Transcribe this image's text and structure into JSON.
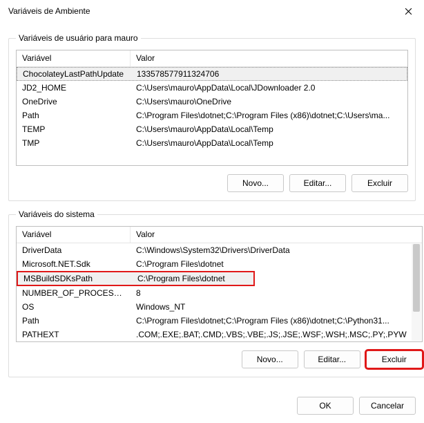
{
  "titlebar": {
    "title": "Variáveis de Ambiente"
  },
  "user_group": {
    "legend": "Variáveis de usuário para mauro",
    "header_var": "Variável",
    "header_val": "Valor",
    "rows": [
      {
        "var": "ChocolateyLastPathUpdate",
        "val": "133578577911324706"
      },
      {
        "var": "JD2_HOME",
        "val": "C:\\Users\\mauro\\AppData\\Local\\JDownloader 2.0"
      },
      {
        "var": "OneDrive",
        "val": "C:\\Users\\mauro\\OneDrive"
      },
      {
        "var": "Path",
        "val": "C:\\Program Files\\dotnet;C:\\Program Files (x86)\\dotnet;C:\\Users\\ma..."
      },
      {
        "var": "TEMP",
        "val": "C:\\Users\\mauro\\AppData\\Local\\Temp"
      },
      {
        "var": "TMP",
        "val": "C:\\Users\\mauro\\AppData\\Local\\Temp"
      }
    ],
    "selected_index": 0,
    "buttons": {
      "novo": "Novo...",
      "editar": "Editar...",
      "excluir": "Excluir"
    }
  },
  "system_group": {
    "legend": "Variáveis do sistema",
    "header_var": "Variável",
    "header_val": "Valor",
    "rows": [
      {
        "var": "DriverData",
        "val": "C:\\Windows\\System32\\Drivers\\DriverData"
      },
      {
        "var": "Microsoft.NET.Sdk",
        "val": "C:\\Program Files\\dotnet"
      },
      {
        "var": "MSBuildSDKsPath",
        "val": "C:\\Program Files\\dotnet"
      },
      {
        "var": "NUMBER_OF_PROCESSORS",
        "val": "8"
      },
      {
        "var": "OS",
        "val": "Windows_NT"
      },
      {
        "var": "Path",
        "val": "C:\\Program Files\\dotnet;C:\\Program Files (x86)\\dotnet;C:\\Python31..."
      },
      {
        "var": "PATHEXT",
        "val": ".COM;.EXE;.BAT;.CMD;.VBS;.VBE;.JS;.JSE;.WSF;.WSH;.MSC;.PY;.PYW"
      }
    ],
    "highlight_index": 2,
    "buttons": {
      "novo": "Novo...",
      "editar": "Editar...",
      "excluir": "Excluir"
    }
  },
  "footer": {
    "ok": "OK",
    "cancel": "Cancelar"
  }
}
